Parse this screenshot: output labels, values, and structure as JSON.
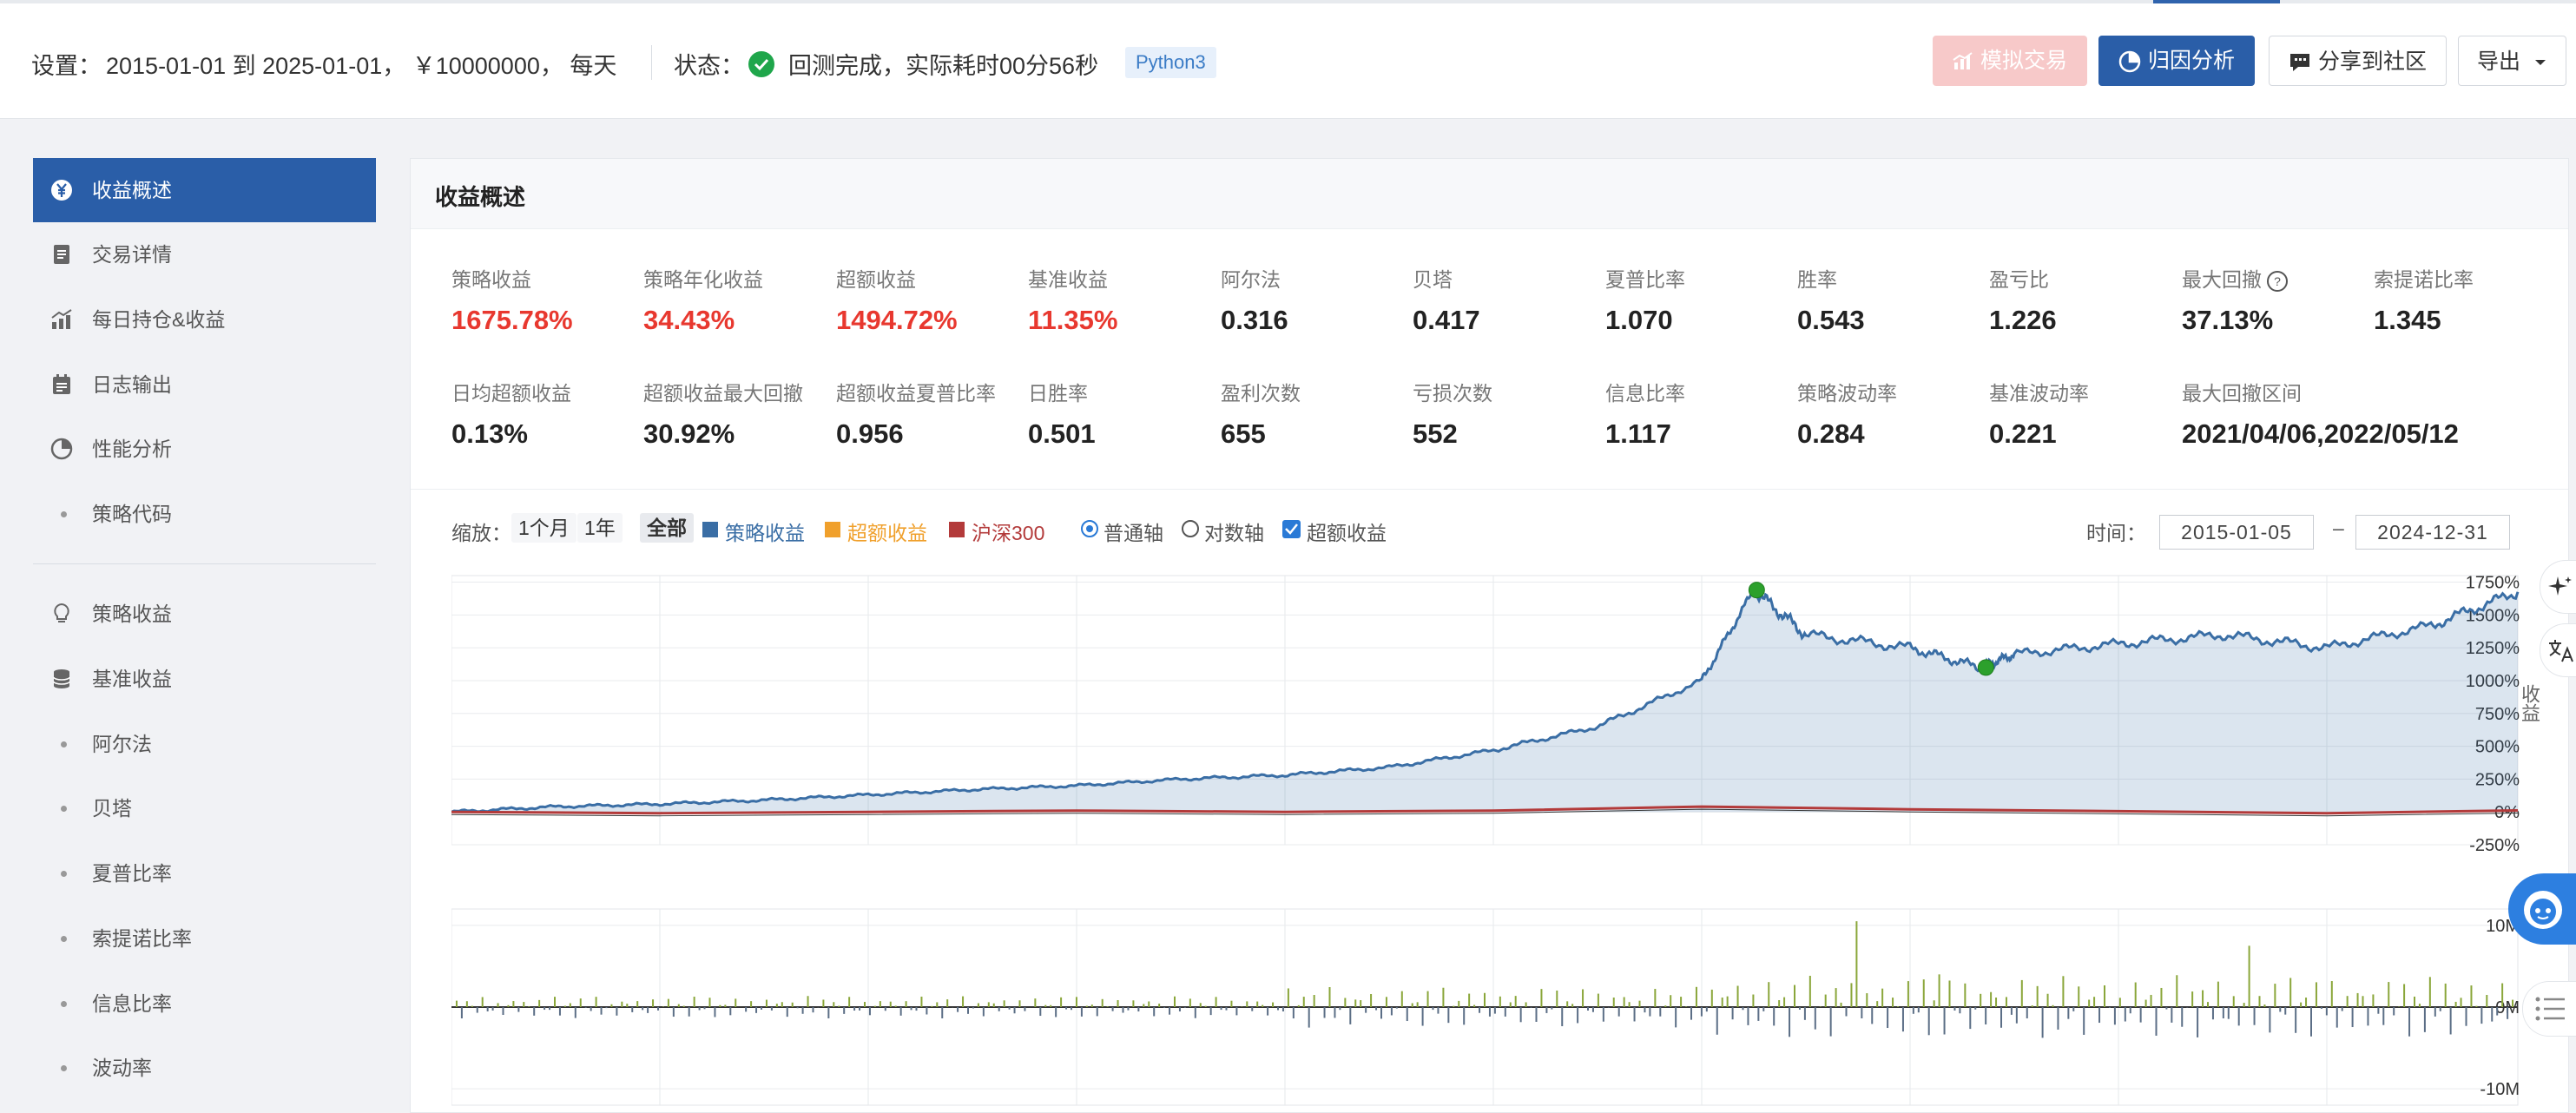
{
  "header": {
    "settings_label": "设置：",
    "settings_value": "2015-01-01 到 2025-01-01， ￥10000000， 每天",
    "status_label": "状态：",
    "status_value": "回测完成，实际耗时00分56秒",
    "python_badge": "Python3",
    "buttons": {
      "simulate": "模拟交易",
      "attribution": "归因分析",
      "share": "分享到社区",
      "export": "导出"
    }
  },
  "sidebar": {
    "items": [
      {
        "label": "收益概述",
        "icon": "yen-circle-icon"
      },
      {
        "label": "交易详情",
        "icon": "document-icon"
      },
      {
        "label": "每日持仓&收益",
        "icon": "bar-chart-up-icon"
      },
      {
        "label": "日志输出",
        "icon": "calendar-icon"
      },
      {
        "label": "性能分析",
        "icon": "pie-icon"
      },
      {
        "label": "策略代码",
        "icon": "dot"
      }
    ],
    "items2": [
      {
        "label": "策略收益",
        "icon": "bulb-icon"
      },
      {
        "label": "基准收益",
        "icon": "database-icon"
      },
      {
        "label": "阿尔法",
        "icon": "dot"
      },
      {
        "label": "贝塔",
        "icon": "dot"
      },
      {
        "label": "夏普比率",
        "icon": "dot"
      },
      {
        "label": "索提诺比率",
        "icon": "dot"
      },
      {
        "label": "信息比率",
        "icon": "dot"
      },
      {
        "label": "波动率",
        "icon": "dot"
      }
    ]
  },
  "panel": {
    "title": "收益概述",
    "metrics_row1": [
      {
        "label": "策略收益",
        "value": "1675.78%",
        "red": true
      },
      {
        "label": "策略年化收益",
        "value": "34.43%",
        "red": true
      },
      {
        "label": "超额收益",
        "value": "1494.72%",
        "red": true
      },
      {
        "label": "基准收益",
        "value": "11.35%",
        "red": true
      },
      {
        "label": "阿尔法",
        "value": "0.316"
      },
      {
        "label": "贝塔",
        "value": "0.417"
      },
      {
        "label": "夏普比率",
        "value": "1.070"
      },
      {
        "label": "胜率",
        "value": "0.543"
      },
      {
        "label": "盈亏比",
        "value": "1.226"
      },
      {
        "label": "最大回撤",
        "value": "37.13%"
      },
      {
        "label": "索提诺比率",
        "value": "1.345"
      }
    ],
    "metrics_row2": [
      {
        "label": "日均超额收益",
        "value": "0.13%"
      },
      {
        "label": "超额收益最大回撤",
        "value": "30.92%"
      },
      {
        "label": "超额收益夏普比率",
        "value": "0.956"
      },
      {
        "label": "日胜率",
        "value": "0.501"
      },
      {
        "label": "盈利次数",
        "value": "655"
      },
      {
        "label": "亏损次数",
        "value": "552"
      },
      {
        "label": "信息比率",
        "value": "1.117"
      },
      {
        "label": "策略波动率",
        "value": "0.284"
      },
      {
        "label": "基准波动率",
        "value": "0.221"
      },
      {
        "label": "最大回撤区间",
        "value": "2021/04/06,2022/05/12"
      }
    ]
  },
  "toolbar": {
    "zoom_label": "缩放：",
    "zoom_options": [
      "1个月",
      "1年",
      "全部"
    ],
    "legend": [
      {
        "label": "策略收益",
        "color": "#3a6ea5"
      },
      {
        "label": "超额收益",
        "color": "#f0a02c"
      },
      {
        "label": "沪深300",
        "color": "#b33a3a"
      }
    ],
    "axis_options": [
      "普通轴",
      "对数轴"
    ],
    "excess_checkbox": "超额收益",
    "time_label": "时间：",
    "date_from": "2015-01-05",
    "date_sep": "–",
    "date_to": "2024-12-31"
  },
  "side_labels": {
    "right_tab": "收益"
  },
  "chart_data": [
    {
      "type": "area",
      "series": [
        {
          "name": "策略收益",
          "color": "#3a6ea5",
          "x": [
            "2015-01",
            "2015-07",
            "2016-01",
            "2016-07",
            "2017-01",
            "2017-07",
            "2018-01",
            "2018-07",
            "2019-01",
            "2019-07",
            "2020-01",
            "2020-07",
            "2021-01",
            "2021-04",
            "2021-07",
            "2022-01",
            "2022-05",
            "2022-07",
            "2023-01",
            "2023-07",
            "2024-01",
            "2024-07",
            "2024-12"
          ],
          "values": [
            0,
            40,
            60,
            90,
            130,
            170,
            200,
            250,
            280,
            340,
            470,
            650,
            1000,
            1690,
            1350,
            1250,
            1100,
            1200,
            1280,
            1350,
            1250,
            1420,
            1676
          ]
        },
        {
          "name": "沪深300",
          "color": "#b33a3a",
          "x": [
            "2015-01",
            "2016-01",
            "2017-01",
            "2018-01",
            "2019-01",
            "2020-01",
            "2021-01",
            "2022-01",
            "2023-01",
            "2024-01",
            "2024-12"
          ],
          "values": [
            0,
            -10,
            0,
            10,
            0,
            10,
            40,
            20,
            5,
            -10,
            11
          ]
        }
      ],
      "yticks": [
        "1750%",
        "1500%",
        "1250%",
        "1000%",
        "750%",
        "500%",
        "250%",
        "0%",
        "-250%"
      ],
      "ylim": [
        -250,
        1800
      ],
      "markers": [
        {
          "label": "max-drawdown-start",
          "x": "2021-04-06",
          "y": 1690,
          "color": "#2ca02c"
        },
        {
          "label": "max-drawdown-end",
          "x": "2022-05-12",
          "y": 1100,
          "color": "#2ca02c"
        }
      ]
    },
    {
      "type": "bar",
      "yticks": [
        "10M",
        "0M",
        "-10M"
      ],
      "ylim": [
        -12,
        12
      ]
    }
  ]
}
